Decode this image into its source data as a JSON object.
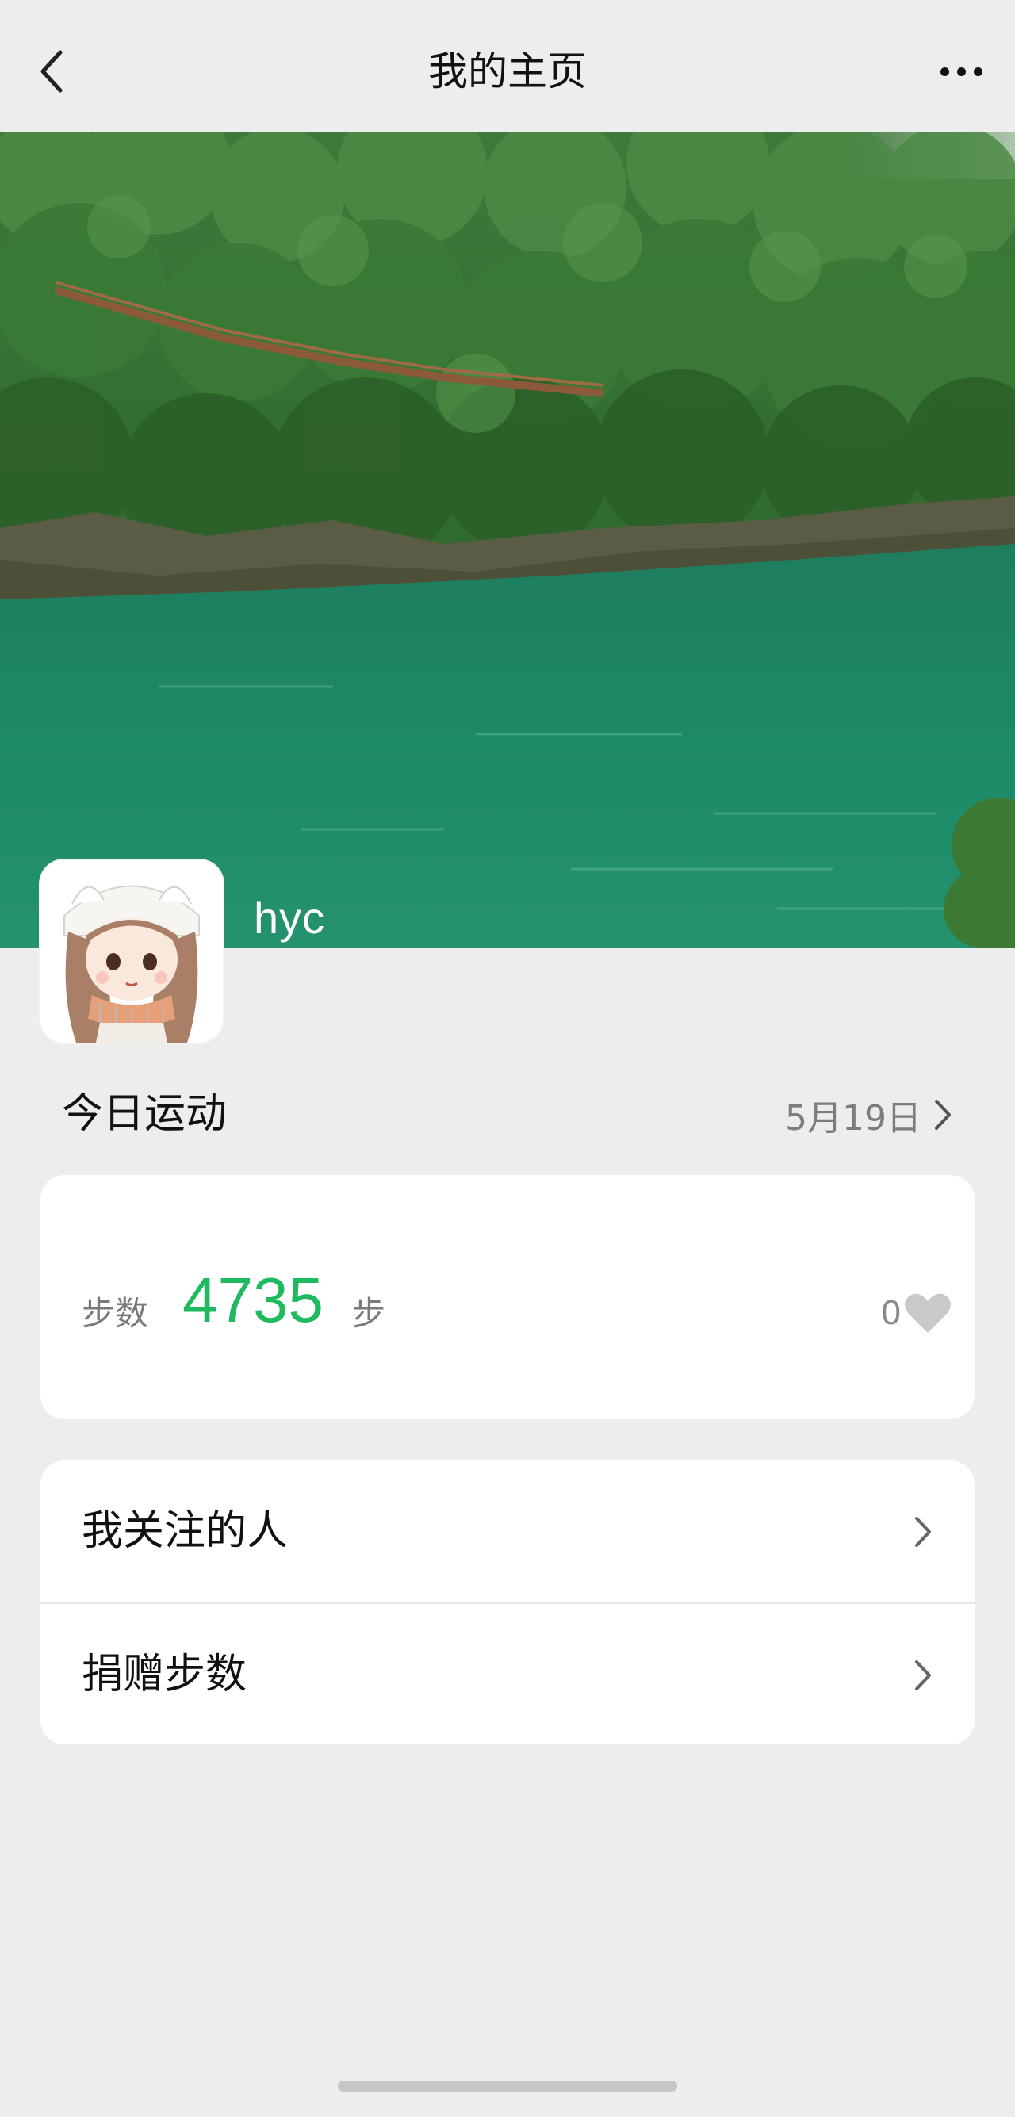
{
  "nav": {
    "title": "我的主页",
    "back_icon": "chevron-left-icon",
    "more_icon": "more-dots-icon"
  },
  "profile": {
    "username": "hyc"
  },
  "today": {
    "title": "今日运动",
    "date": "5月19日"
  },
  "steps": {
    "label": "步数",
    "value": "4735",
    "unit": "步",
    "likes": "0"
  },
  "menu": {
    "items": [
      {
        "label": "我关注的人"
      },
      {
        "label": "捐赠步数"
      }
    ]
  },
  "colors": {
    "accent_green": "#1fba5f",
    "background": "#ededed",
    "card": "#ffffff"
  }
}
